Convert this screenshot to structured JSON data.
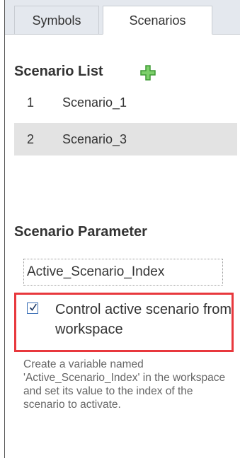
{
  "tabs": [
    {
      "label": "Symbols",
      "active": false
    },
    {
      "label": "Scenarios",
      "active": true
    }
  ],
  "scenario_list": {
    "title": "Scenario List",
    "add_icon": "plus-icon",
    "accent_color": "#5cb85c",
    "items": [
      {
        "index": "1",
        "name": "Scenario_1",
        "selected": false
      },
      {
        "index": "2",
        "name": "Scenario_3",
        "selected": true
      }
    ]
  },
  "scenario_parameter": {
    "title": "Scenario Parameter",
    "field_value": "Active_Scenario_Index",
    "checkbox_label": "Control active scenario from workspace",
    "checkbox_checked": true,
    "help_text": "Create a variable named 'Active_Scenario_Index' in the workspace and set its value to the index of the scenario to activate.",
    "highlight_color": "#e8383d"
  }
}
